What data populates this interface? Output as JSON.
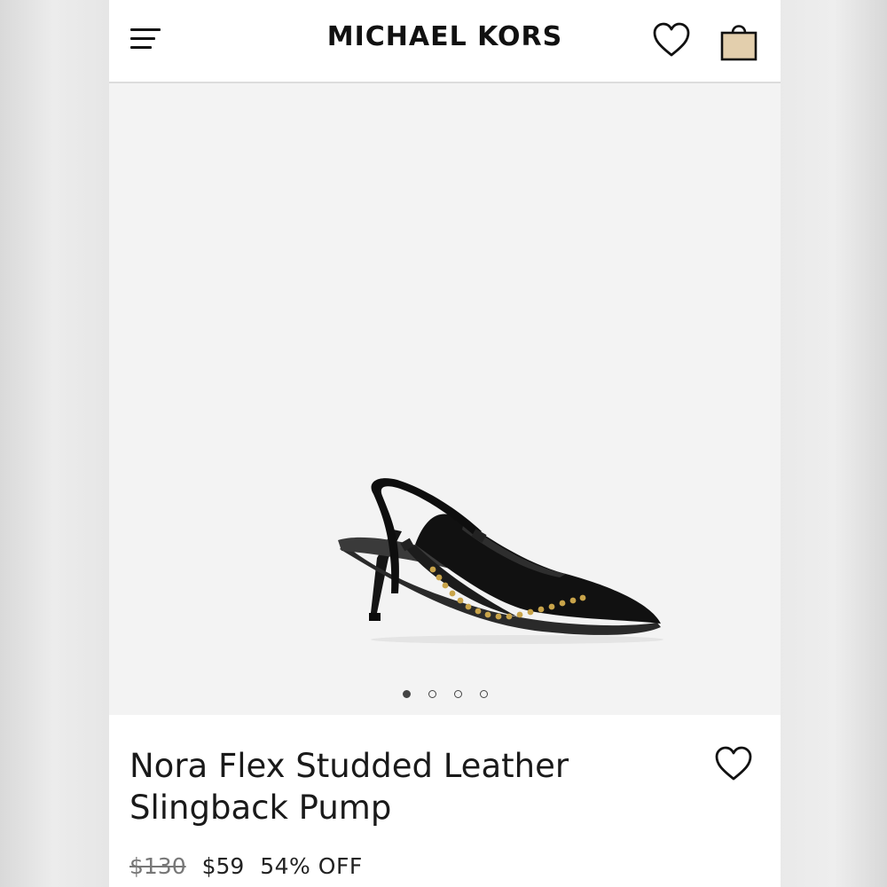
{
  "header": {
    "brand": "MICHAEL KORS",
    "menu_icon": "hamburger-menu-icon",
    "wishlist_icon": "heart-outline-icon",
    "bag_icon": "shopping-bag-icon",
    "bag_color": "#e3cfad"
  },
  "gallery": {
    "image_subject": "black-studded-slingback-pump",
    "image_count": 4,
    "active_index": 0
  },
  "product": {
    "name_line1": "Nora Flex Studded Leather",
    "name_line2": "Slingback Pump",
    "original_price": "$130",
    "sale_price": "$59",
    "discount": "54% OFF",
    "wishlist_icon": "heart-outline-icon"
  },
  "colors": {
    "text": "#1a1a1a",
    "hero_background": "#f3f3f3",
    "stud_gold": "#c9a44a"
  }
}
